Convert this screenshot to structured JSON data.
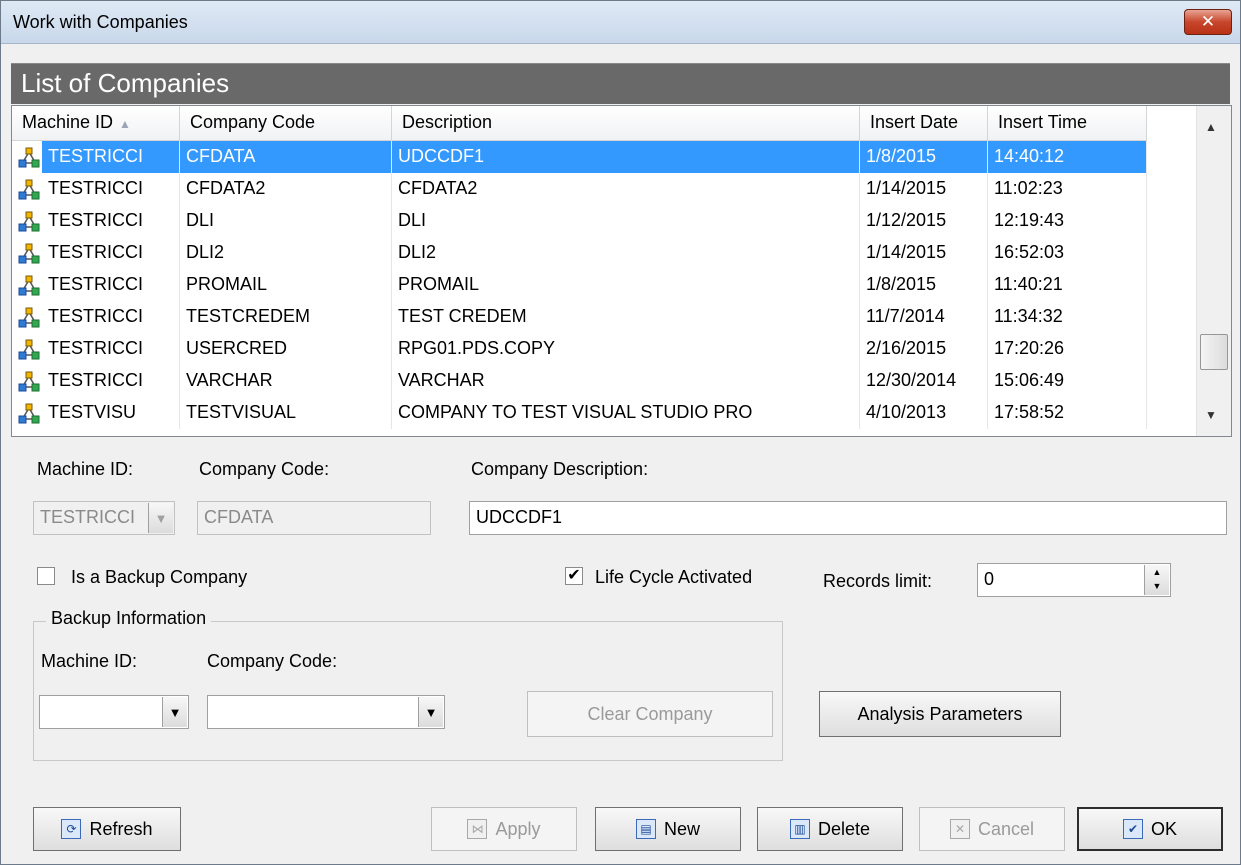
{
  "window": {
    "title": "Work with Companies",
    "close_glyph": "✕"
  },
  "list": {
    "title": "List of Companies",
    "columns": [
      "Machine ID",
      "Company Code",
      "Description",
      "Insert Date",
      "Insert Time"
    ],
    "rows": [
      [
        "TESTRICCI",
        "CFDATA",
        "UDCCDF1",
        "1/8/2015",
        "14:40:12"
      ],
      [
        "TESTRICCI",
        "CFDATA2",
        "CFDATA2",
        "1/14/2015",
        "11:02:23"
      ],
      [
        "TESTRICCI",
        "DLI",
        "DLI",
        "1/12/2015",
        "12:19:43"
      ],
      [
        "TESTRICCI",
        "DLI2",
        "DLI2",
        "1/14/2015",
        "16:52:03"
      ],
      [
        "TESTRICCI",
        "PROMAIL",
        "PROMAIL",
        "1/8/2015",
        "11:40:21"
      ],
      [
        "TESTRICCI",
        "TESTCREDEM",
        "TEST CREDEM",
        "11/7/2014",
        "11:34:32"
      ],
      [
        "TESTRICCI",
        "USERCRED",
        "RPG01.PDS.COPY",
        "2/16/2015",
        "17:20:26"
      ],
      [
        "TESTRICCI",
        "VARCHAR",
        "VARCHAR",
        "12/30/2014",
        "15:06:49"
      ],
      [
        "TESTVISU",
        "TESTVISUAL",
        "COMPANY TO TEST VISUAL STUDIO PRO",
        "4/10/2013",
        "17:58:52"
      ]
    ],
    "selected_index": 0,
    "row_icon": "network-company-icon"
  },
  "form": {
    "machine_id_label": "Machine ID:",
    "machine_id_value": "TESTRICCI",
    "company_code_label": "Company Code:",
    "company_code_value": "CFDATA",
    "company_desc_label": "Company Description:",
    "company_desc_value": "UDCCDF1",
    "backup_checkbox_label": "Is a Backup Company",
    "lifecycle_label": "Life Cycle Activated",
    "records_limit_label": "Records limit:",
    "records_limit_value": "0"
  },
  "backup": {
    "group_title": "Backup Information",
    "machine_id_label": "Machine ID:",
    "company_code_label": "Company Code:",
    "clear_button": "Clear Company"
  },
  "buttons": {
    "analysis": "Analysis Parameters",
    "refresh": "Refresh",
    "apply": "Apply",
    "new": "New",
    "delete": "Delete",
    "cancel": "Cancel",
    "ok": "OK"
  },
  "colors": {
    "selection": "#3399ff",
    "header_band": "#696969"
  }
}
